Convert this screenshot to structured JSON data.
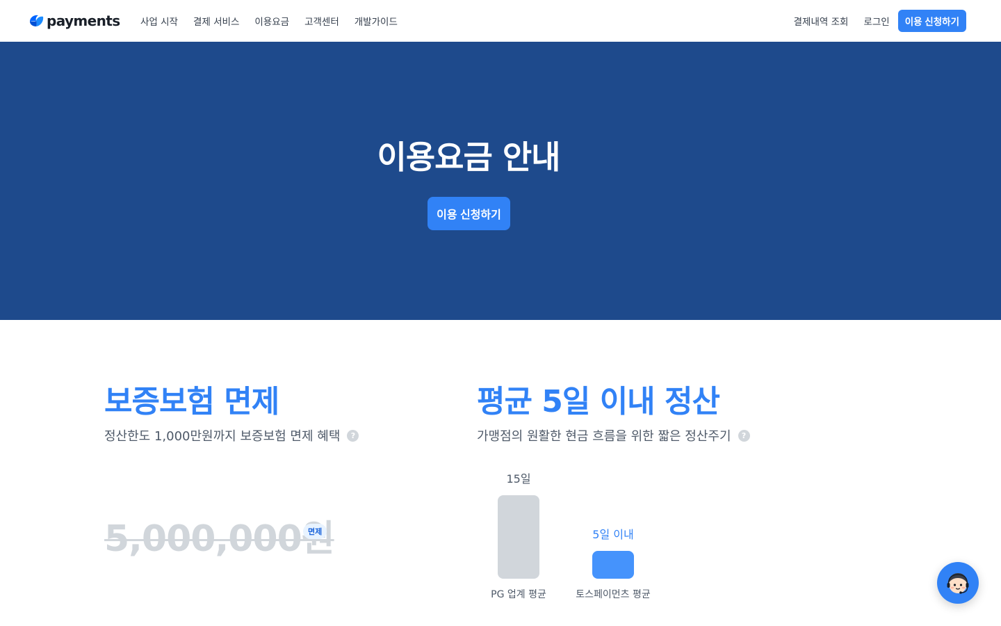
{
  "header": {
    "logo_text": "payments",
    "nav": [
      {
        "label": "사업 시작"
      },
      {
        "label": "결제 서비스"
      },
      {
        "label": "이용요금"
      },
      {
        "label": "고객센터"
      },
      {
        "label": "개발가이드"
      }
    ],
    "history_label": "결제내역 조회",
    "login_label": "로그인",
    "apply_label": "이용 신청하기"
  },
  "hero": {
    "title": "이용요금 안내",
    "cta_label": "이용 신청하기",
    "bg_color": "#1e4a8c"
  },
  "features": {
    "insurance": {
      "title": "보증보험 면제",
      "subtitle": "정산한도 1,000만원까지 보증보험 면제 혜택",
      "help_icon": "?",
      "struck_price": "5,000,000원",
      "badge": "면제"
    },
    "settlement": {
      "title": "평균 5일 이내 정산",
      "subtitle": "가맹점의 원활한 현금 흐름을 위한 짧은 정산주기",
      "help_icon": "?"
    }
  },
  "chart_data": {
    "type": "bar",
    "categories": [
      "PG 업계 평균",
      "토스페이먼츠 평균"
    ],
    "values": [
      15,
      5
    ],
    "data_labels": [
      "15일",
      "5일 이내"
    ],
    "colors": [
      "#d1d6db",
      "#4593fc"
    ],
    "label_colors": [
      "#4e5968",
      "#3182f6"
    ],
    "ylim": [
      0,
      15
    ]
  },
  "chat": {
    "icon": "support-agent-icon"
  },
  "colors": {
    "accent": "#3182f6",
    "text_primary": "#191f28",
    "text_secondary": "#4e5968",
    "muted": "#d1d6db"
  }
}
